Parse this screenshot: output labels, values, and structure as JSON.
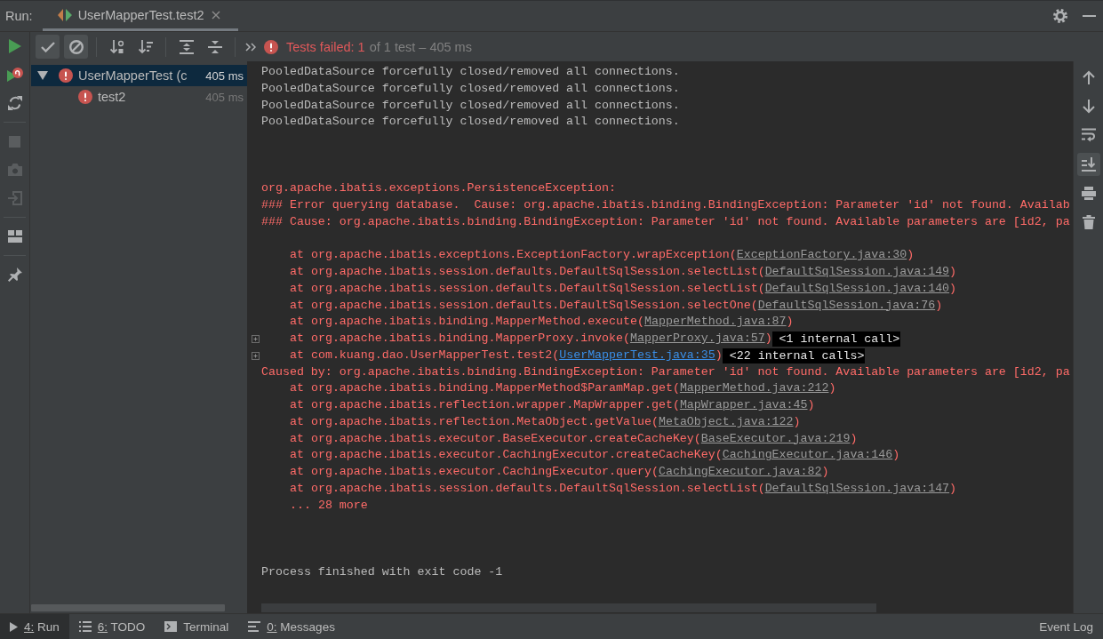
{
  "header": {
    "label": "Run:",
    "tabs": [
      {
        "label": "UserMapperTest.test2",
        "selected": true
      }
    ]
  },
  "side_toolbar": {
    "groups": [
      {
        "buttons": [
          {
            "kind": "run",
            "disabled": false
          },
          {
            "kind": "rerun",
            "disabled": false
          },
          {
            "kind": "autotest",
            "disabled": false
          }
        ]
      },
      {
        "buttons": [
          {
            "kind": "stop",
            "disabled": true
          },
          {
            "kind": "snapshot",
            "disabled": true
          },
          {
            "kind": "import",
            "disabled": true
          }
        ]
      },
      {
        "buttons": [
          {
            "kind": "layout",
            "disabled": false
          }
        ]
      },
      {
        "buttons": [
          {
            "kind": "pin",
            "disabled": false
          }
        ]
      }
    ]
  },
  "toolbar": {
    "groups": [
      {
        "buttons": [
          {
            "kind": "passed",
            "on": true
          },
          {
            "kind": "ignored",
            "on": true
          }
        ]
      },
      {
        "buttons": [
          {
            "kind": "sortalpha",
            "on": false
          },
          {
            "kind": "sortduration",
            "on": false
          }
        ]
      },
      {
        "buttons": [
          {
            "kind": "expand"
          },
          {
            "kind": "collapse"
          }
        ]
      }
    ],
    "status": {
      "kind": "failed",
      "failed": "Tests failed: 1",
      "summary": "of 1 test – 405 ms"
    }
  },
  "tree": [
    {
      "label": "UserMapperTest (c",
      "duration": "405 ms",
      "kind": "failed",
      "selected": true,
      "expanded": true,
      "children": [
        {
          "label": "test2",
          "duration": "405 ms",
          "kind": "failed",
          "selected": false
        }
      ]
    }
  ],
  "console": {
    "lines": [
      {
        "kind": "output",
        "text": "PooledDataSource forcefully closed/removed all connections."
      },
      {
        "kind": "output",
        "text": "PooledDataSource forcefully closed/removed all connections."
      },
      {
        "kind": "output",
        "text": "PooledDataSource forcefully closed/removed all connections."
      },
      {
        "kind": "output",
        "text": "PooledDataSource forcefully closed/removed all connections."
      },
      {
        "kind": "blank"
      },
      {
        "kind": "blank"
      },
      {
        "kind": "blank"
      },
      {
        "kind": "error",
        "text": "org.apache.ibatis.exceptions.PersistenceException:"
      },
      {
        "kind": "error",
        "text": "### Error querying database.  Cause: org.apache.ibatis.binding.BindingException: Parameter 'id' not found. Availab"
      },
      {
        "kind": "error",
        "text": "### Cause: org.apache.ibatis.binding.BindingException: Parameter 'id' not found. Available parameters are [id2, pa"
      },
      {
        "kind": "blank"
      },
      {
        "kind": "frame",
        "text": "at org.apache.ibatis.exceptions.ExceptionFactory.wrapException(",
        "link": {
          "text": "ExceptionFactory.java:30",
          "kind": "library"
        },
        "after": ")"
      },
      {
        "kind": "frame",
        "text": "at org.apache.ibatis.session.defaults.DefaultSqlSession.selectList(",
        "link": {
          "text": "DefaultSqlSession.java:149",
          "kind": "library"
        },
        "after": ")"
      },
      {
        "kind": "frame",
        "text": "at org.apache.ibatis.session.defaults.DefaultSqlSession.selectList(",
        "link": {
          "text": "DefaultSqlSession.java:140",
          "kind": "library"
        },
        "after": ")"
      },
      {
        "kind": "frame",
        "text": "at org.apache.ibatis.session.defaults.DefaultSqlSession.selectOne(",
        "link": {
          "text": "DefaultSqlSession.java:76",
          "kind": "library"
        },
        "after": ")"
      },
      {
        "kind": "frame",
        "text": "at org.apache.ibatis.binding.MapperMethod.execute(",
        "link": {
          "text": "MapperMethod.java:87",
          "kind": "library"
        },
        "after": ")"
      },
      {
        "kind": "frame",
        "text": "at org.apache.ibatis.binding.MapperProxy.invoke(",
        "link": {
          "text": "MapperProxy.java:57",
          "kind": "library"
        },
        "after": ")",
        "folded": "<1 internal call>"
      },
      {
        "kind": "frame",
        "text": "at com.kuang.dao.UserMapperTest.test2(",
        "link": {
          "text": "UserMapperTest.java:35",
          "kind": "source"
        },
        "after": ")",
        "folded": "<22 internal calls>"
      },
      {
        "kind": "error",
        "text": "Caused by: org.apache.ibatis.binding.BindingException: Parameter 'id' not found. Available parameters are [id2, pa"
      },
      {
        "kind": "frame",
        "text": "at org.apache.ibatis.binding.MapperMethod$ParamMap.get(",
        "link": {
          "text": "MapperMethod.java:212",
          "kind": "library"
        },
        "after": ")"
      },
      {
        "kind": "frame",
        "text": "at org.apache.ibatis.reflection.wrapper.MapWrapper.get(",
        "link": {
          "text": "MapWrapper.java:45",
          "kind": "library"
        },
        "after": ")"
      },
      {
        "kind": "frame",
        "text": "at org.apache.ibatis.reflection.MetaObject.getValue(",
        "link": {
          "text": "MetaObject.java:122",
          "kind": "library"
        },
        "after": ")"
      },
      {
        "kind": "frame",
        "text": "at org.apache.ibatis.executor.BaseExecutor.createCacheKey(",
        "link": {
          "text": "BaseExecutor.java:219",
          "kind": "library"
        },
        "after": ")"
      },
      {
        "kind": "frame",
        "text": "at org.apache.ibatis.executor.CachingExecutor.createCacheKey(",
        "link": {
          "text": "CachingExecutor.java:146",
          "kind": "library"
        },
        "after": ")"
      },
      {
        "kind": "frame",
        "text": "at org.apache.ibatis.executor.CachingExecutor.query(",
        "link": {
          "text": "CachingExecutor.java:82",
          "kind": "library"
        },
        "after": ")"
      },
      {
        "kind": "frame",
        "text": "at org.apache.ibatis.session.defaults.DefaultSqlSession.selectList(",
        "link": {
          "text": "DefaultSqlSession.java:147",
          "kind": "library"
        },
        "after": ")"
      },
      {
        "kind": "frame",
        "text": "... 28 more"
      },
      {
        "kind": "blank"
      },
      {
        "kind": "blank"
      },
      {
        "kind": "blank"
      },
      {
        "kind": "output",
        "text": "Process finished with exit code -1"
      }
    ]
  },
  "console_toolbar": [
    {
      "kind": "up"
    },
    {
      "kind": "down"
    },
    {
      "kind": "wrap",
      "on": false
    },
    {
      "kind": "scrollend",
      "on": true
    },
    {
      "kind": "print"
    },
    {
      "kind": "clear"
    }
  ],
  "tool_windows": [
    {
      "kind": "run",
      "label": "4: Run",
      "mnemonic": true,
      "selected": true
    },
    {
      "kind": "todo",
      "label": "6: TODO",
      "mnemonic": true,
      "selected": false
    },
    {
      "kind": "terminal",
      "label": "Terminal",
      "mnemonic": false,
      "selected": false
    },
    {
      "kind": "messages",
      "label": "0: Messages",
      "mnemonic": true,
      "selected": false
    }
  ],
  "right_tool_windows": [
    {
      "label": "Event Log",
      "selected": false
    }
  ]
}
